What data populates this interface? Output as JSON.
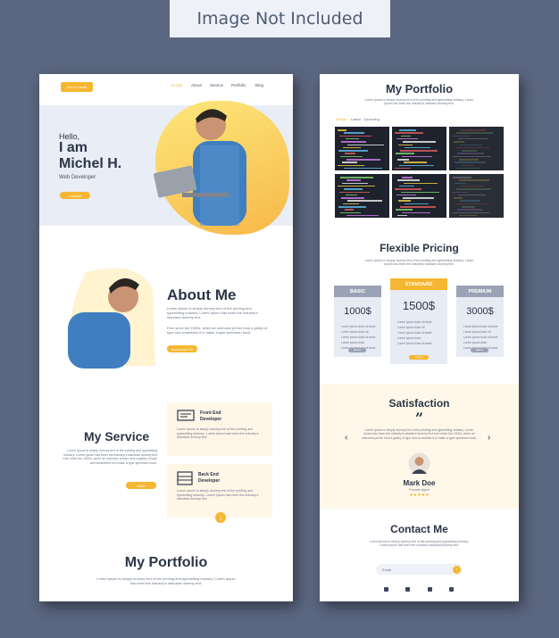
{
  "banner": {
    "text": "Image Not Included"
  },
  "left": {
    "header": {
      "cta": "Get in Touch",
      "nav": [
        "Home",
        "About",
        "Service",
        "Portfolio",
        "Blog"
      ]
    },
    "hero": {
      "greeting": "Hello,",
      "line1": "I am",
      "name": "Michel H.",
      "role": "Web Developer",
      "button": "Contact"
    },
    "about": {
      "title": "About Me",
      "p1": "Lorem Ipsum is simply dummy text of the printing and typesetting industry. Lorem Ipsum has been the industry's standard dummy text.",
      "p2": "Ever since the 1500s, when an unknown printer took a galley of type and scrambled it to make a type specimen book.",
      "button": "Download CV"
    },
    "service": {
      "title": "My Service",
      "text": "Lorem Ipsum is simply dummy text of the printing and typesetting industry. Lorem Ipsum has been the industry's standard dummy text ever since the 1500s, when an unknown printer took a galley of type and scrambled it to make a type specimen book.",
      "button": "More",
      "cards": [
        {
          "title1": "Front End",
          "title2": "Developer",
          "text": "Lorem Ipsum is simply dummy text of the printing and typesetting industry. Lorem Ipsum has been the industry's standard dummy text."
        },
        {
          "title1": "Back End",
          "title2": "Developer",
          "text": "Lorem Ipsum is simply dummy text of the printing and typesetting industry. Lorem Ipsum has been the industry's standard dummy text."
        }
      ]
    },
    "portfolio": {
      "title": "My Portfolio",
      "text": "Lorem Ipsum is simply dummy text of the printing and typesetting industry. Lorem Ipsum has been the industry's standard dummy text."
    }
  },
  "right": {
    "portfolio": {
      "title": "My Portfolio",
      "text": "Lorem Ipsum is simply dummy text of the printing and typesetting industry. Lorem Ipsum has been the industry's standard dummy text.",
      "tabs": [
        "Design",
        "Latest",
        "Upcoming"
      ]
    },
    "pricing": {
      "title": "Flexible Pricing",
      "text": "Lorem Ipsum is simply dummy text of the printing and typesetting industry. Lorem Ipsum has been the industry's standard dummy text.",
      "plans": [
        {
          "name": "BASIC",
          "price": "1000$",
          "button": "Select",
          "color": "#9aa3b5"
        },
        {
          "name": "STANDARD",
          "price": "1500$",
          "button": "Select",
          "color": "#f5b731"
        },
        {
          "name": "PREMIUM",
          "price": "3000$",
          "button": "Select",
          "color": "#9aa3b5"
        }
      ],
      "features": [
        "Lorem ipsum dolor sit amet",
        "Lorem ipsum dolor sit",
        "Lorem ipsum dolor sit amet",
        "Lorem ipsum dolor",
        "Lorem ipsum dolor sit amet"
      ]
    },
    "satisfaction": {
      "title": "Satisfaction",
      "quote_mark": "”",
      "text": "Lorem Ipsum is simply dummy text of the printing and typesetting industry. Lorem Ipsum has been the industry's standard dummy text ever since the 1500s, when an unknown printer took a galley of type and scrambled it to make a type specimen book.",
      "name": "Mark Doe",
      "position": "Founder Agent",
      "stars": "★★★★★"
    },
    "contact": {
      "title": "Contact Me",
      "text": "Lorem Ipsum is simply dummy text of the printing and typesetting industry. Lorem Ipsum has been the industry's standard dummy text.",
      "email_placeholder": "Email"
    }
  },
  "colors": {
    "accent": "#f5b731",
    "dark": "#2b3548",
    "background": "#5b6680",
    "hero_bg": "#e9edf5",
    "card_bg": "#fff6e7"
  }
}
